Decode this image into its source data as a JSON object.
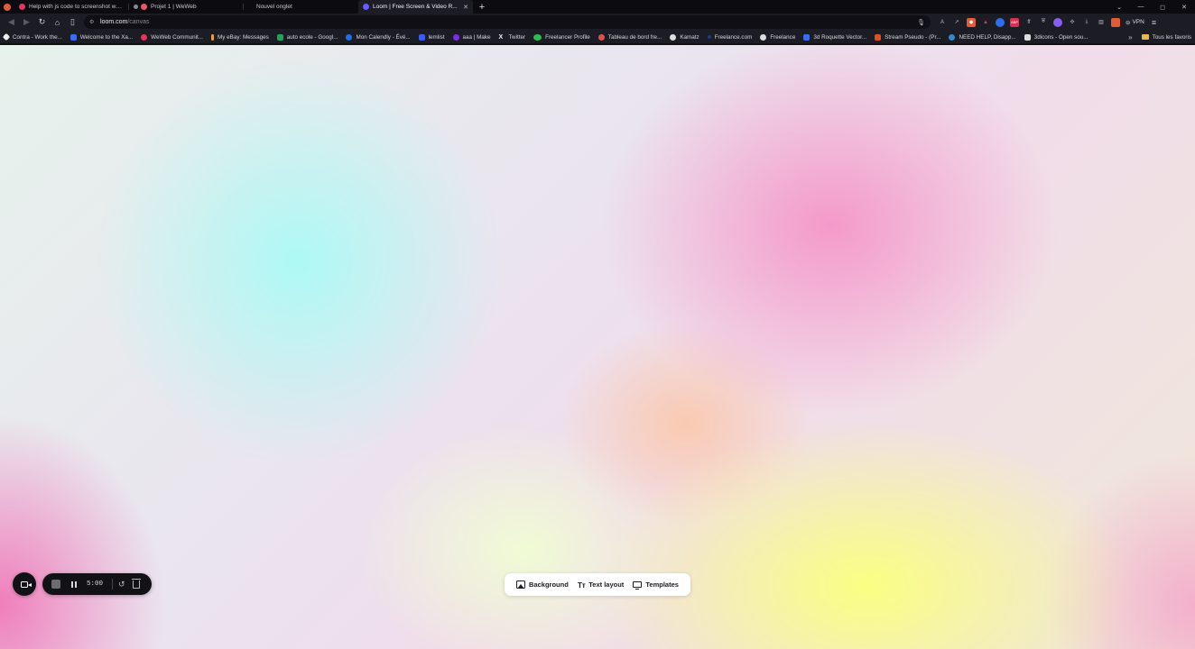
{
  "tabs": [
    {
      "title": "Help with js code to screenshot webc...",
      "favicon_color": "#e0365f",
      "active": false
    },
    {
      "title": "Projet 1 | WeWeb",
      "favicon_color": "#e85a6a",
      "active": false
    },
    {
      "title": "Nouvel onglet",
      "favicon_color": "",
      "active": false
    },
    {
      "title": "Loom | Free Screen & Video R...",
      "favicon_color": "#6a5cf6",
      "active": true
    }
  ],
  "new_tab_label": "+",
  "window_controls": {
    "tab_search": "⌄",
    "minimize": "—",
    "maximize": "◻",
    "close": "✕"
  },
  "address": {
    "host": "loom.com",
    "path": "/canvas"
  },
  "vpn_label": "VPN",
  "bookmarks": [
    {
      "label": "Contra - Work the...",
      "color": "#eeeeee"
    },
    {
      "label": "Welcome to the Xa...",
      "color": "#3b6cf0"
    },
    {
      "label": "WeWeb Communit...",
      "color": "#e0365f"
    },
    {
      "label": "My eBay: Messages",
      "color": "#e5a23b"
    },
    {
      "label": "auto ecole - Googl...",
      "color": "#22a35a"
    },
    {
      "label": "Mon Calendly - Évé...",
      "color": "#1c6ff0"
    },
    {
      "label": "lemlist",
      "color": "#3b5cf0"
    },
    {
      "label": "aaa | Make",
      "color": "#7b2fe0"
    },
    {
      "label": "Twitter",
      "color": "#eeeeee"
    },
    {
      "label": "Freelancer Profile",
      "color": "#2bbf4a"
    },
    {
      "label": "Tableau de bord fre...",
      "color": "#e05050"
    },
    {
      "label": "Kamatz",
      "color": "#dddddd"
    },
    {
      "label": "Freelance.com",
      "color": "#1e3a8a"
    },
    {
      "label": "Freelance",
      "color": "#dddddd"
    },
    {
      "label": "3d Roquette Vector...",
      "color": "#3b6cf0"
    },
    {
      "label": "Stream Pseudo - (Pr...",
      "color": "#e05020"
    },
    {
      "label": "NEED HELP, Disapp...",
      "color": "#2b8cd0"
    },
    {
      "label": "3dicons - Open sou...",
      "color": "#dddddd"
    }
  ],
  "bookmarks_more": "»",
  "bookmarks_folder": "Tous les favoris",
  "recorder": {
    "timer": "5:00"
  },
  "canvas_toolbar": [
    {
      "label": "Background",
      "icon": "image-icon"
    },
    {
      "label": "Text layout",
      "icon": "text-icon"
    },
    {
      "label": "Templates",
      "icon": "monitor-icon"
    }
  ]
}
